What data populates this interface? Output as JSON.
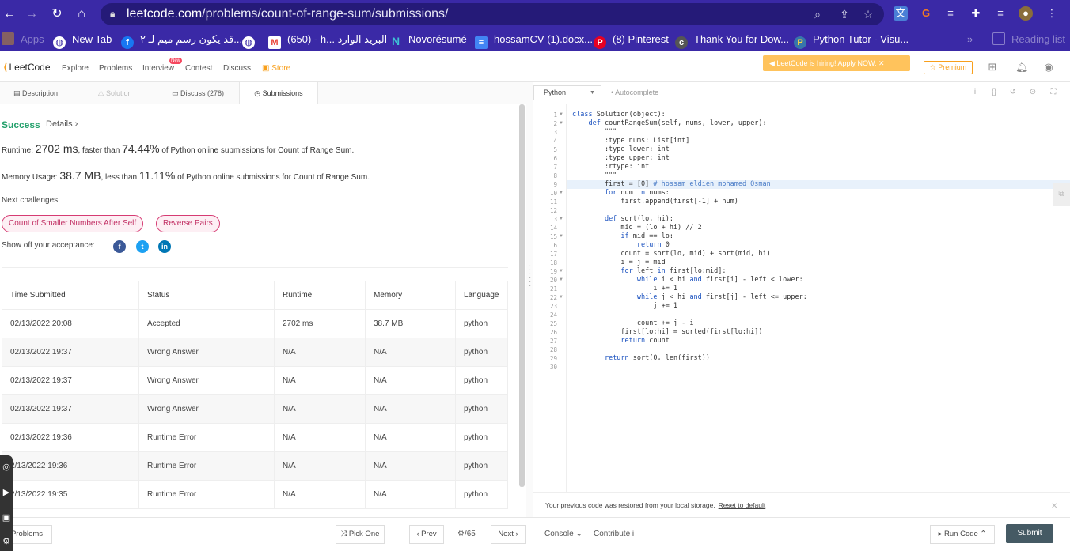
{
  "browser": {
    "url_domain": "leetcode.com",
    "url_path": "/problems/count-of-range-sum/submissions/",
    "bookmarks": [
      {
        "label": "Apps",
        "color": "#f4b400"
      },
      {
        "label": "New Tab",
        "color": "#ffffff"
      },
      {
        "label": "قد يكون رسم ميم لـ ٢...",
        "color": "#1877f2"
      },
      {
        "label": "",
        "color": "#ffffff"
      },
      {
        "label": "(650) - h... البريد الوارد",
        "color": "#ea4335"
      },
      {
        "label": "Novorésumé",
        "color": "#3ec2d6"
      },
      {
        "label": "hossamCV (1).docx...",
        "color": "#4285f4"
      },
      {
        "label": "(8) Pinterest",
        "color": "#e60023"
      },
      {
        "label": "Thank You for Dow...",
        "color": "#555555"
      },
      {
        "label": "Python Tutor - Visu...",
        "color": "#3776ab"
      }
    ],
    "reading_list": "Reading list"
  },
  "lcnav": {
    "logo": "LeetCode",
    "items": [
      "Explore",
      "Problems",
      "Interview",
      "Contest",
      "Discuss",
      "Store"
    ],
    "new_badge": "New",
    "hiring": "LeetCode is hiring! Apply NOW.",
    "premium": "Premium"
  },
  "tabs": [
    "Description",
    "Solution",
    "Discuss (278)",
    "Submissions"
  ],
  "result": {
    "status": "Success",
    "details": "Details",
    "runtime_prefix": "Runtime:",
    "runtime_value": "2702 ms",
    "runtime_mid": ", faster than",
    "runtime_pct": "74.44%",
    "runtime_suffix": "of Python online submissions for Count of Range Sum.",
    "memory_prefix": "Memory Usage:",
    "memory_value": "38.7 MB",
    "memory_mid": ", less than",
    "memory_pct": "11.11%",
    "memory_suffix": "of Python online submissions for Count of Range Sum.",
    "next_challenges": "Next challenges:",
    "challenges": [
      "Count of Smaller Numbers After Self",
      "Reverse Pairs"
    ],
    "share_label": "Show off your acceptance:"
  },
  "table": {
    "headers": [
      "Time Submitted",
      "Status",
      "Runtime",
      "Memory",
      "Language"
    ],
    "rows": [
      [
        "02/13/2022 20:08",
        "Accepted",
        "2702 ms",
        "38.7 MB",
        "python"
      ],
      [
        "02/13/2022 19:37",
        "Wrong Answer",
        "N/A",
        "N/A",
        "python"
      ],
      [
        "02/13/2022 19:37",
        "Wrong Answer",
        "N/A",
        "N/A",
        "python"
      ],
      [
        "02/13/2022 19:37",
        "Wrong Answer",
        "N/A",
        "N/A",
        "python"
      ],
      [
        "02/13/2022 19:36",
        "Runtime Error",
        "N/A",
        "N/A",
        "python"
      ],
      [
        "2/13/2022 19:36",
        "Runtime Error",
        "N/A",
        "N/A",
        "python"
      ],
      [
        "2/13/2022 19:35",
        "Runtime Error",
        "N/A",
        "N/A",
        "python"
      ]
    ]
  },
  "editor": {
    "language": "Python",
    "autocomplete": "Autocomplete",
    "lines": [
      "class Solution(object):",
      "    def countRangeSum(self, nums, lower, upper):",
      "        \"\"\"",
      "        :type nums: List[int]",
      "        :type lower: int",
      "        :type upper: int",
      "        :rtype: int",
      "        \"\"\"",
      "        first = [0] # hossam eldien mohamed Osman",
      "        for num in nums:",
      "            first.append(first[-1] + num)",
      "",
      "        def sort(lo, hi):",
      "            mid = (lo + hi) // 2",
      "            if mid == lo:",
      "                return 0",
      "            count = sort(lo, mid) + sort(mid, hi)",
      "            i = j = mid",
      "            for left in first[lo:mid]:",
      "                while i < hi and first[i] - left < lower:",
      "                    i += 1",
      "                while j < hi and first[j] - left <= upper:",
      "                    j += 1",
      "",
      "                count += j - i",
      "            first[lo:hi] = sorted(first[lo:hi])",
      "            return count",
      "",
      "        return sort(0, len(first))",
      ""
    ],
    "restore_msg": "Your previous code was restored from your local storage.",
    "reset_link": "Reset to default"
  },
  "footer": {
    "problems": "Problems",
    "pick_one": "Pick One",
    "prev": "Prev",
    "page": "/65",
    "next": "Next",
    "console": "Console",
    "contribute": "Contribute",
    "run_code": "Run Code",
    "submit": "Submit"
  }
}
